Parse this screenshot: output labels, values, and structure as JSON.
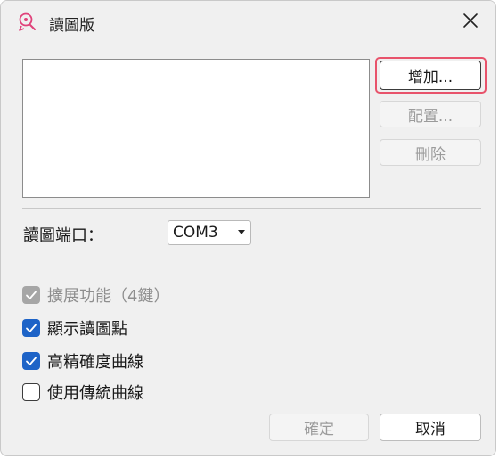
{
  "window": {
    "title": "讀圖版",
    "title_icon": "tablet-pen-icon",
    "close_icon": "close-icon"
  },
  "buttons": {
    "add": "增加...",
    "configure": "配置...",
    "delete": "刪除",
    "ok": "確定",
    "cancel": "取消"
  },
  "port": {
    "label": "讀圖端口：",
    "selected": "COM3"
  },
  "checkboxes": [
    {
      "label": "擴展功能（4鍵）",
      "checked": true,
      "disabled": true
    },
    {
      "label": "顯示讀圖點",
      "checked": true,
      "disabled": false
    },
    {
      "label": "高精確度曲線",
      "checked": true,
      "disabled": false
    },
    {
      "label": "使用傳統曲線",
      "checked": false,
      "disabled": false
    }
  ],
  "colors": {
    "accent": "#1d63c7",
    "focus_ring": "#e8536b",
    "icon_pink": "#e0427a"
  }
}
